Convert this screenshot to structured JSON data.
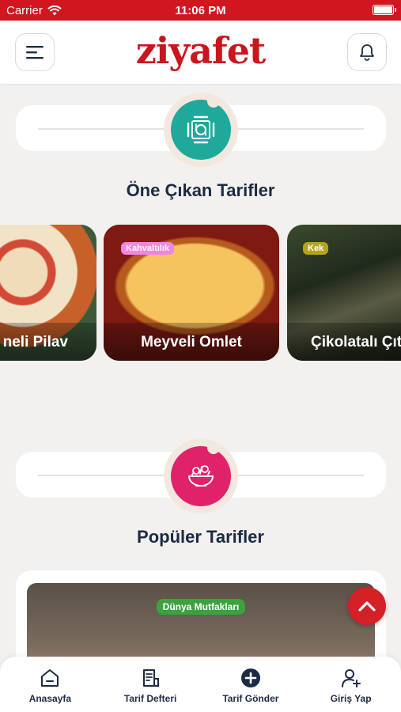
{
  "status_bar": {
    "carrier": "Carrier",
    "time": "11:06 PM"
  },
  "header": {
    "logo": "ziyafet",
    "menu_icon": "menu-icon",
    "bell_icon": "bell-icon"
  },
  "featured": {
    "title": "Öne Çıkan Tarifler",
    "icon": "dining-table-icon",
    "icon_color": "#1fa99a",
    "slides": [
      {
        "title": "neli Pilav",
        "category": ""
      },
      {
        "title": "Meyveli Omlet",
        "category": "Kahvaltılık",
        "category_color": "#ef86e0"
      },
      {
        "title": "Çikolatalı Çıtı",
        "category": "Kek",
        "category_color": "#b5a31b"
      }
    ]
  },
  "popular": {
    "title": "Popüler Tarifler",
    "icon": "salad-bowl-icon",
    "icon_color": "#e0226a",
    "card": {
      "category": "Dünya Mutfakları",
      "category_color": "#3aa33e"
    }
  },
  "scroll_top": {
    "icon": "chevron-up-icon",
    "color": "#d42027"
  },
  "tabbar": {
    "items": [
      {
        "label": "Anasayfa",
        "icon": "home-icon"
      },
      {
        "label": "Tarif Defteri",
        "icon": "notebook-icon"
      },
      {
        "label": "Tarif Gönder",
        "icon": "plus-circle-icon"
      },
      {
        "label": "Giriş Yap",
        "icon": "user-plus-icon"
      }
    ]
  },
  "colors": {
    "brand_red": "#d0161f",
    "navy": "#1c2a44",
    "background": "#f3f1ef"
  }
}
